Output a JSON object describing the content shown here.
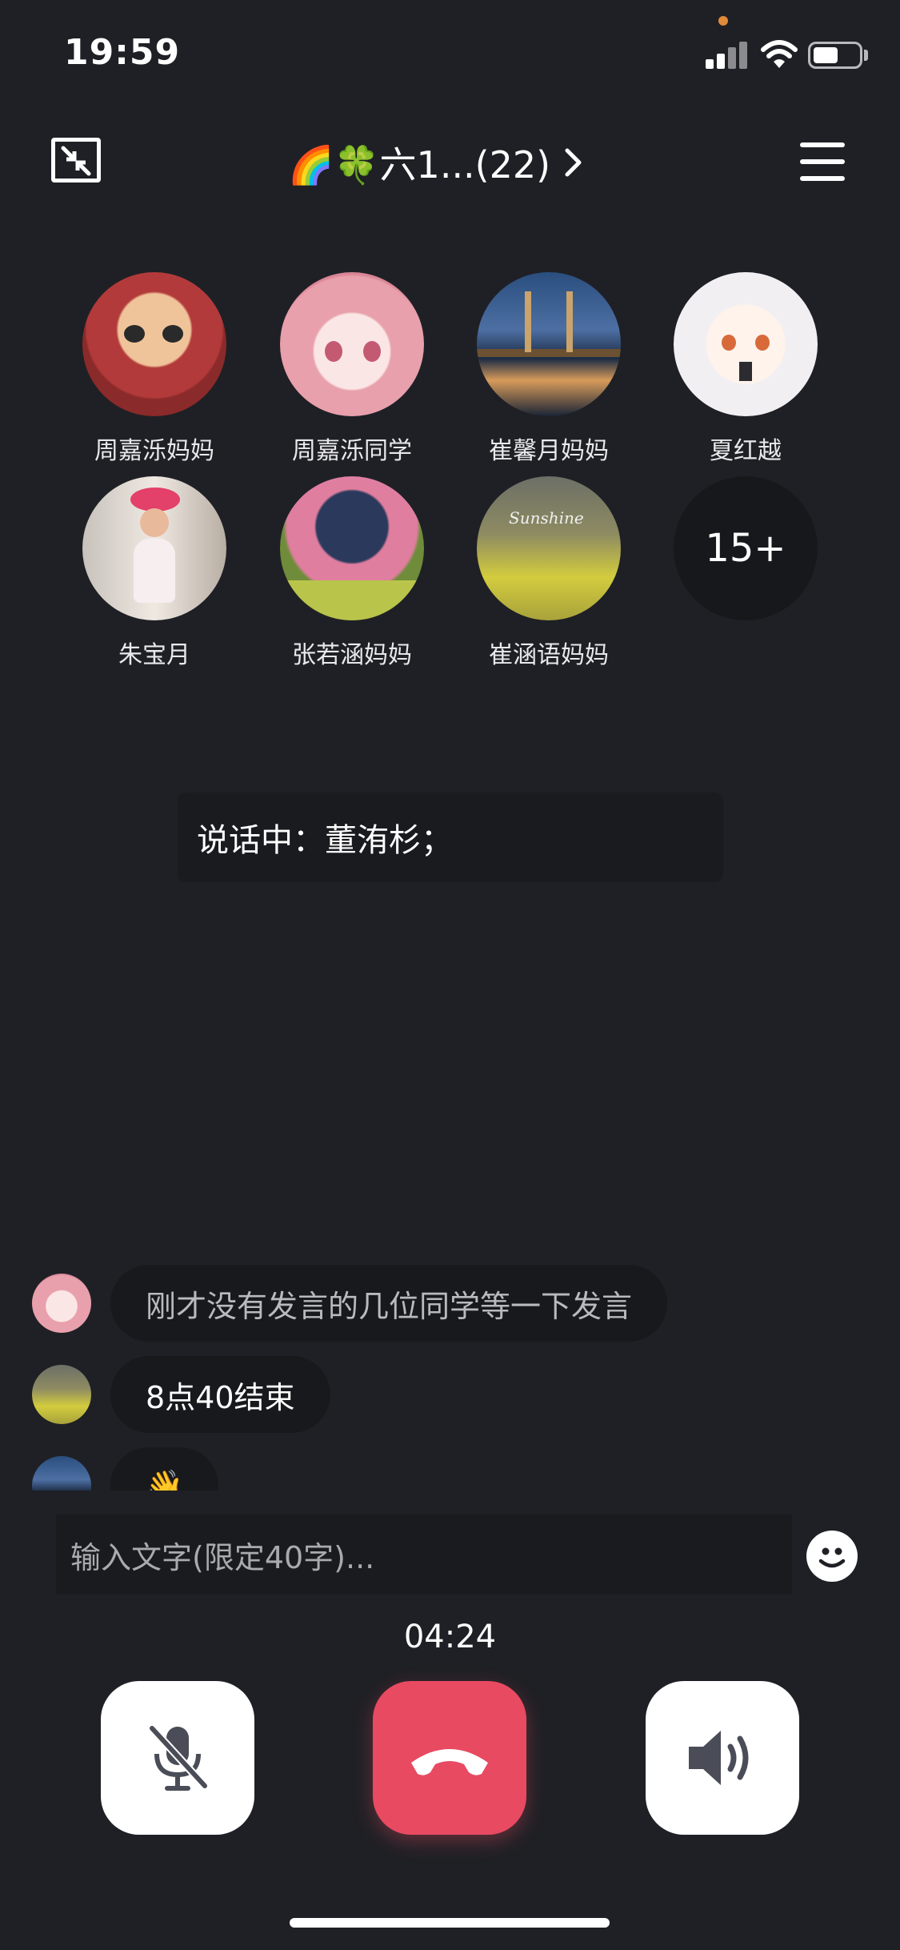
{
  "status_bar": {
    "time": "19:59"
  },
  "header": {
    "title": "🌈🍀六1...(22)",
    "chevron": "›"
  },
  "participants": [
    {
      "name": "周嘉泺妈妈"
    },
    {
      "name": "周嘉泺同学"
    },
    {
      "name": "崔馨月妈妈"
    },
    {
      "name": "夏红越"
    },
    {
      "name": "朱宝月"
    },
    {
      "name": "张若涵妈妈"
    },
    {
      "name": "崔涵语妈妈",
      "avatar_text": "Sunshine"
    }
  ],
  "more_participants": "15+",
  "speaking": "说话中：董洧杉；",
  "messages": [
    {
      "text": "刚才没有发言的几位同学等一下发言"
    },
    {
      "text": "8点40结束"
    },
    {
      "text": "👋"
    }
  ],
  "input": {
    "placeholder": "输入文字(限定40字)..."
  },
  "call": {
    "timer": "04:24"
  },
  "icons": {
    "minimize": "minimize-icon",
    "menu": "menu-icon",
    "emoji": "smiley-icon",
    "mute": "mic-muted-icon",
    "hangup": "hangup-icon",
    "speaker": "speaker-icon"
  },
  "colors": {
    "background": "#1f2025",
    "hangup": "#e84a62",
    "control_bg": "#ffffff",
    "control_icon": "#4a4d57"
  }
}
